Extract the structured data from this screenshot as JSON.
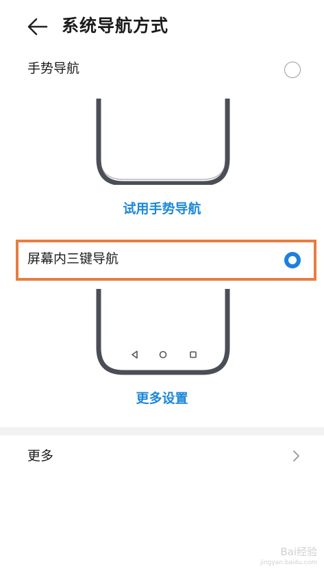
{
  "header": {
    "title": "系统导航方式"
  },
  "options": [
    {
      "label": "手势导航",
      "selected": false,
      "action": "试用手势导航"
    },
    {
      "label": "屏幕内三键导航",
      "selected": true,
      "action": "更多设置"
    }
  ],
  "more": {
    "label": "更多"
  },
  "watermark": {
    "text": "Bai经验",
    "url": "jingyan.baidu.com"
  },
  "colors": {
    "accent": "#1e7fe0",
    "link": "#1e88d8",
    "highlight": "#e87d3e",
    "phone_frame": "#4a4e56"
  }
}
